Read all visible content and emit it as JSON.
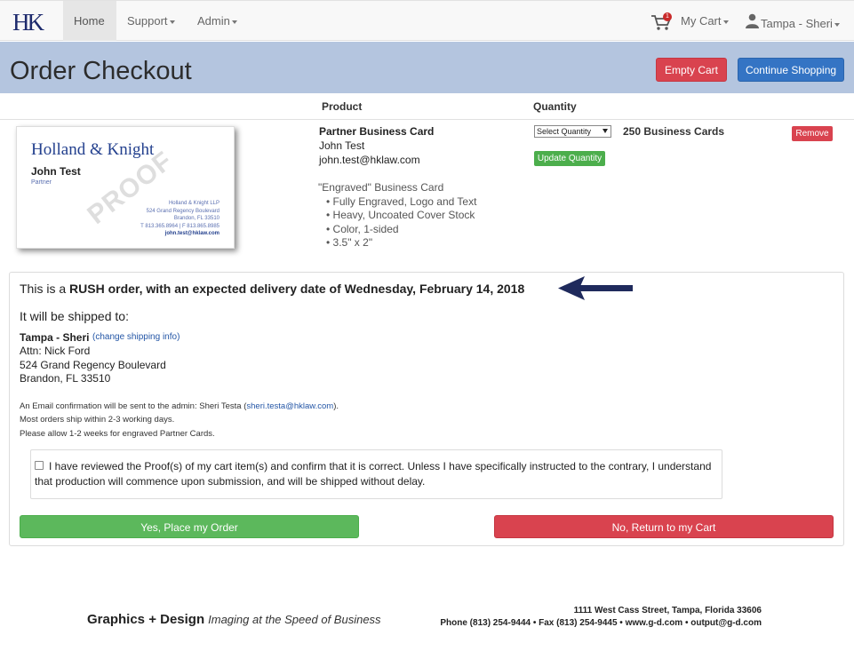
{
  "nav": {
    "logo": "HK",
    "home": "Home",
    "support": "Support",
    "admin": "Admin",
    "cart": "My Cart",
    "cart_count": "1",
    "user": "Tampa - Sheri"
  },
  "header": {
    "title": "Order Checkout",
    "empty_cart": "Empty Cart",
    "continue_shopping": "Continue Shopping"
  },
  "table": {
    "col_product": "Product",
    "col_quantity": "Quantity"
  },
  "proof_card": {
    "firm": "Holland & Knight",
    "name": "John Test",
    "title": "Partner",
    "addr1": "Holland & Knight LLP",
    "addr2": "524 Grand Regency Boulevard",
    "addr3": "Brandon, FL 33510",
    "phone": "T 813.365.8964 | F 813.865.8985",
    "email": "john.test@hklaw.com",
    "watermark": "PROOF"
  },
  "item": {
    "product_name": "Partner Business Card",
    "person": "John Test",
    "email": "john.test@hklaw.com",
    "description": "\"Engraved\" Business Card",
    "bullets": [
      "• Fully Engraved, Logo and Text",
      "• Heavy, Uncoated Cover Stock",
      "• Color, 1-sided",
      "• 3.5\" x 2\""
    ],
    "quantity_select": "Select Quantity",
    "quantity": "250 Business Cards",
    "update_quantity": "Update Quantity",
    "remove": "Remove"
  },
  "order": {
    "rush_prefix": "This is a ",
    "rush_bold": "RUSH order, with an expected delivery date of Wednesday, February 14, 2018",
    "ship_to": "It will be shipped to:",
    "ship_name": "Tampa - Sheri",
    "change_shipping": "(change shipping info)",
    "attn": "Attn: Nick Ford",
    "street": "524 Grand Regency Boulevard",
    "city": "Brandon, FL 33510",
    "email_note_prefix": "An Email confirmation will be sent to the admin: Sheri Testa (",
    "email_note_link": "sheri.testa@hklaw.com",
    "email_note_suffix": ").",
    "ship_note": "Most orders ship within 2-3 working days.",
    "engraved_note": "Please allow 1-2 weeks for engraved Partner Cards.",
    "confirm_text": "I have reviewed the Proof(s) of my cart item(s) and confirm that it is correct. Unless I have specifically instructed to the contrary, I understand that production will commence upon submission, and will be shipped without delay.",
    "place_order": "Yes, Place my Order",
    "return_cart": "No, Return to my Cart"
  },
  "footer": {
    "brand": "Graphics + Design",
    "tagline": "Imaging at the Speed of Business",
    "address": "1111 West Cass Street, Tampa, Florida 33606",
    "contact": "Phone (813) 254-9444 • Fax (813) 254-9445 • www.g-d.com • output@g-d.com"
  },
  "colors": {
    "band": "#b4c5df",
    "danger": "#d9434f",
    "primary": "#3474c4",
    "success": "#5cb85c",
    "arrow": "#1f2a5c"
  }
}
